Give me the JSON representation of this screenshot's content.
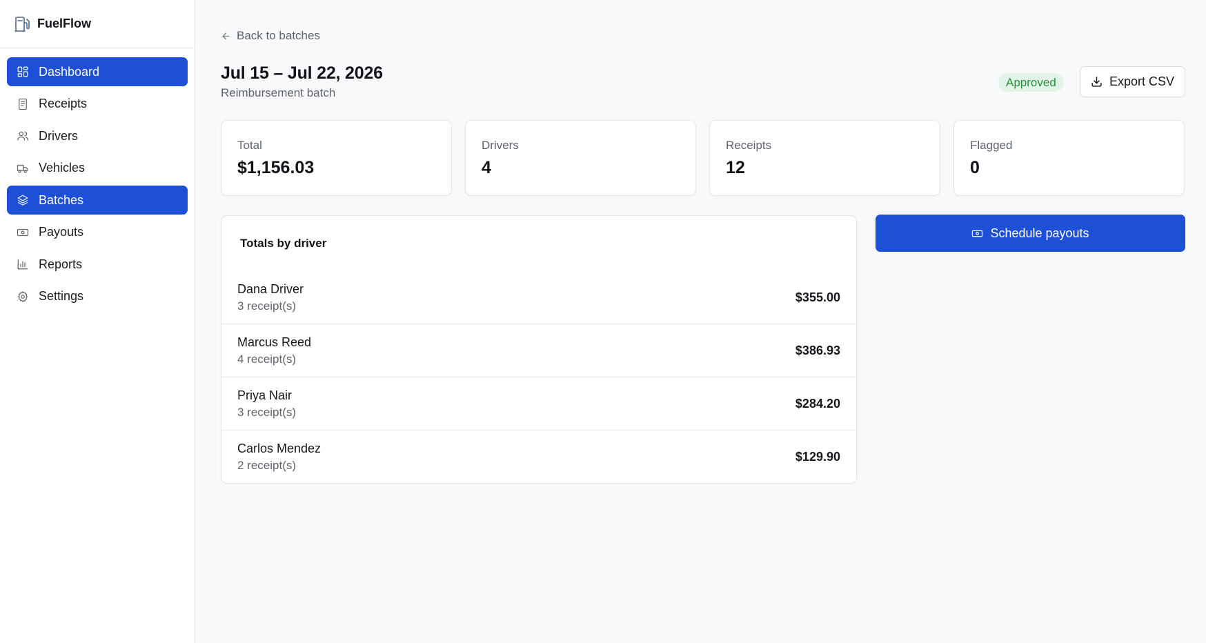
{
  "app": {
    "name": "FuelFlow"
  },
  "sidebar": {
    "items": [
      {
        "label": "Dashboard",
        "icon": "dashboard-icon",
        "active": true
      },
      {
        "label": "Receipts",
        "icon": "receipt-icon",
        "active": false
      },
      {
        "label": "Drivers",
        "icon": "users-icon",
        "active": false
      },
      {
        "label": "Vehicles",
        "icon": "truck-icon",
        "active": false
      },
      {
        "label": "Batches",
        "icon": "layers-icon",
        "active": true
      },
      {
        "label": "Payouts",
        "icon": "banknote-icon",
        "active": false
      },
      {
        "label": "Reports",
        "icon": "bar-chart-icon",
        "active": false
      },
      {
        "label": "Settings",
        "icon": "gear-icon",
        "active": false
      }
    ]
  },
  "header": {
    "back_label": "Back to batches",
    "title": "Jul 15 – Jul 22, 2026",
    "subtitle": "Reimbursement batch",
    "status": "Approved",
    "export_label": "Export CSV"
  },
  "stats": [
    {
      "label": "Total",
      "value": "$1,156.03"
    },
    {
      "label": "Drivers",
      "value": "4"
    },
    {
      "label": "Receipts",
      "value": "12"
    },
    {
      "label": "Flagged",
      "value": "0"
    }
  ],
  "drivers_card": {
    "title": "Totals by driver",
    "rows": [
      {
        "name": "Dana Driver",
        "count": "3 receipt(s)",
        "amount": "$355.00"
      },
      {
        "name": "Marcus Reed",
        "count": "4 receipt(s)",
        "amount": "$386.93"
      },
      {
        "name": "Priya Nair",
        "count": "3 receipt(s)",
        "amount": "$284.20"
      },
      {
        "name": "Carlos Mendez",
        "count": "2 receipt(s)",
        "amount": "$129.90"
      }
    ]
  },
  "actions": {
    "schedule_label": "Schedule payouts"
  },
  "colors": {
    "accent": "#1d4fd7",
    "status_bg": "#e4f3e8",
    "status_text": "#23913f"
  }
}
